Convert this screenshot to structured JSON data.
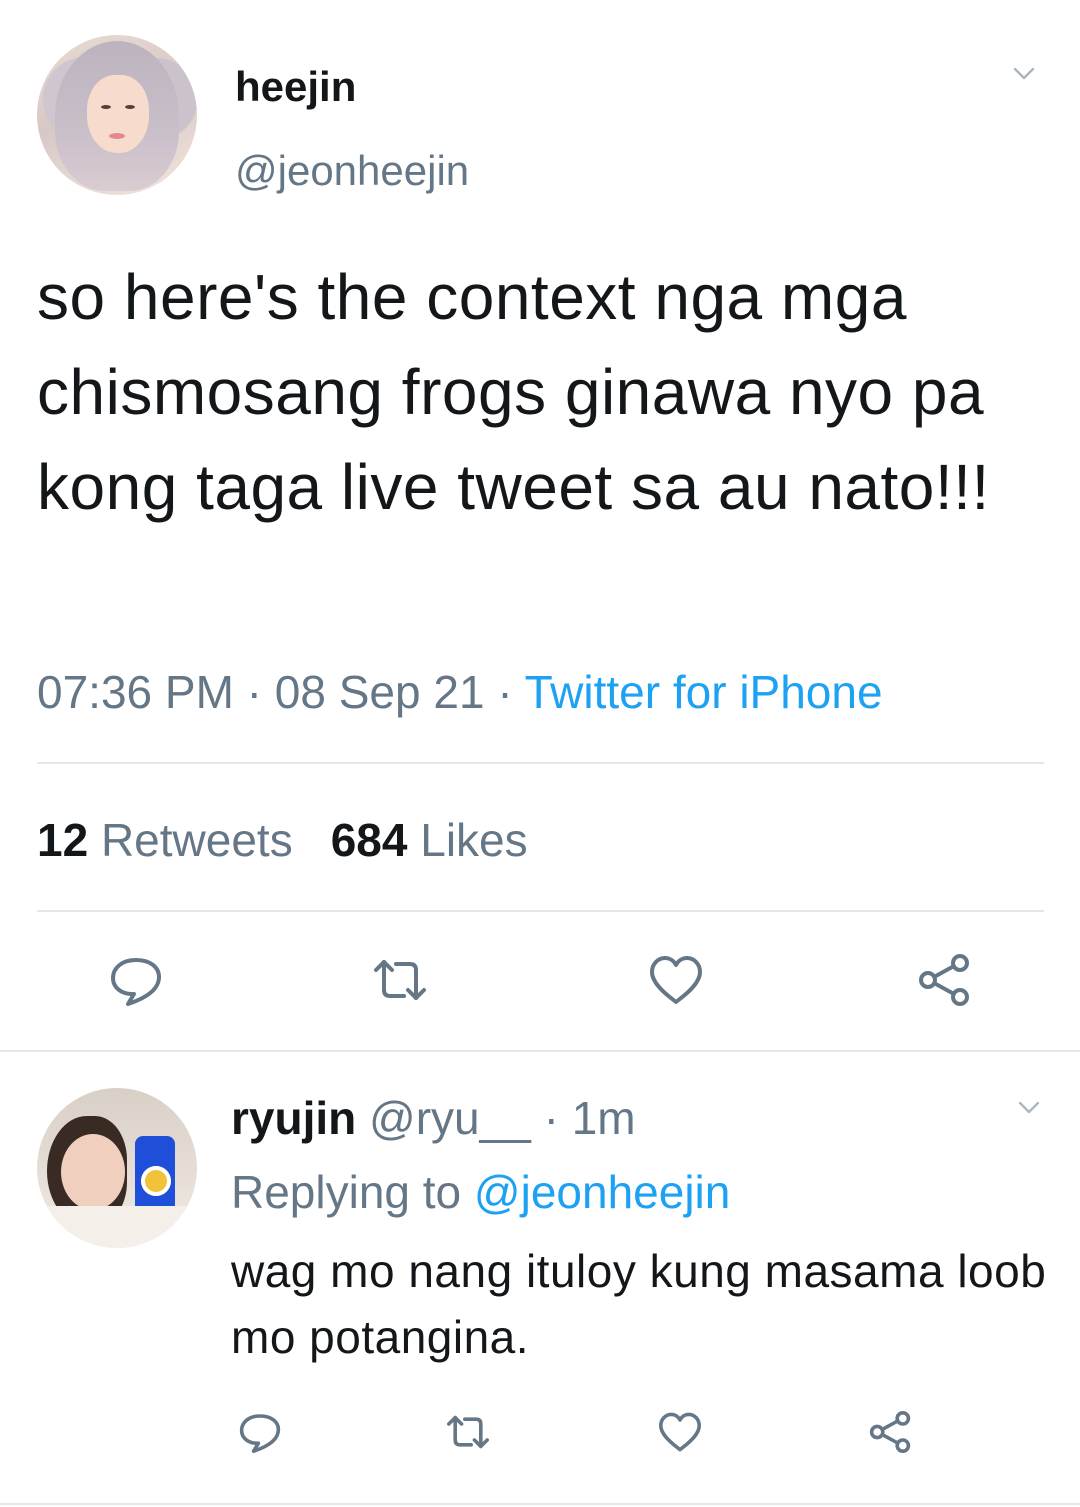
{
  "main_tweet": {
    "display_name": "heejin",
    "handle": "@jeonheejin",
    "text": "so here's the context nga mga chismosang frogs ginawa nyo pa kong taga live tweet sa au nato!!!",
    "time": "07:36 PM",
    "separator": " · ",
    "date": "08 Sep 21",
    "source": "Twitter for iPhone",
    "retweets_count": "12",
    "retweets_label": "Retweets",
    "likes_count": "684",
    "likes_label": "Likes"
  },
  "reply": {
    "display_name": "ryujin",
    "handle": "@ryu__",
    "time_separator": " · ",
    "time": "1m",
    "replying_prefix": "Replying to ",
    "replying_to": "@jeonheejin",
    "text": "wag mo nang ituloy kung masama loob mo potangina."
  },
  "icons": {
    "reply": "reply-icon",
    "retweet": "retweet-icon",
    "like": "heart-icon",
    "share": "share-icon",
    "menu": "chevron-down-icon"
  },
  "colors": {
    "text_primary": "#14171a",
    "text_secondary": "#657786",
    "link": "#1da1f2",
    "divider": "#e1e8ed",
    "icon": "#657786"
  }
}
